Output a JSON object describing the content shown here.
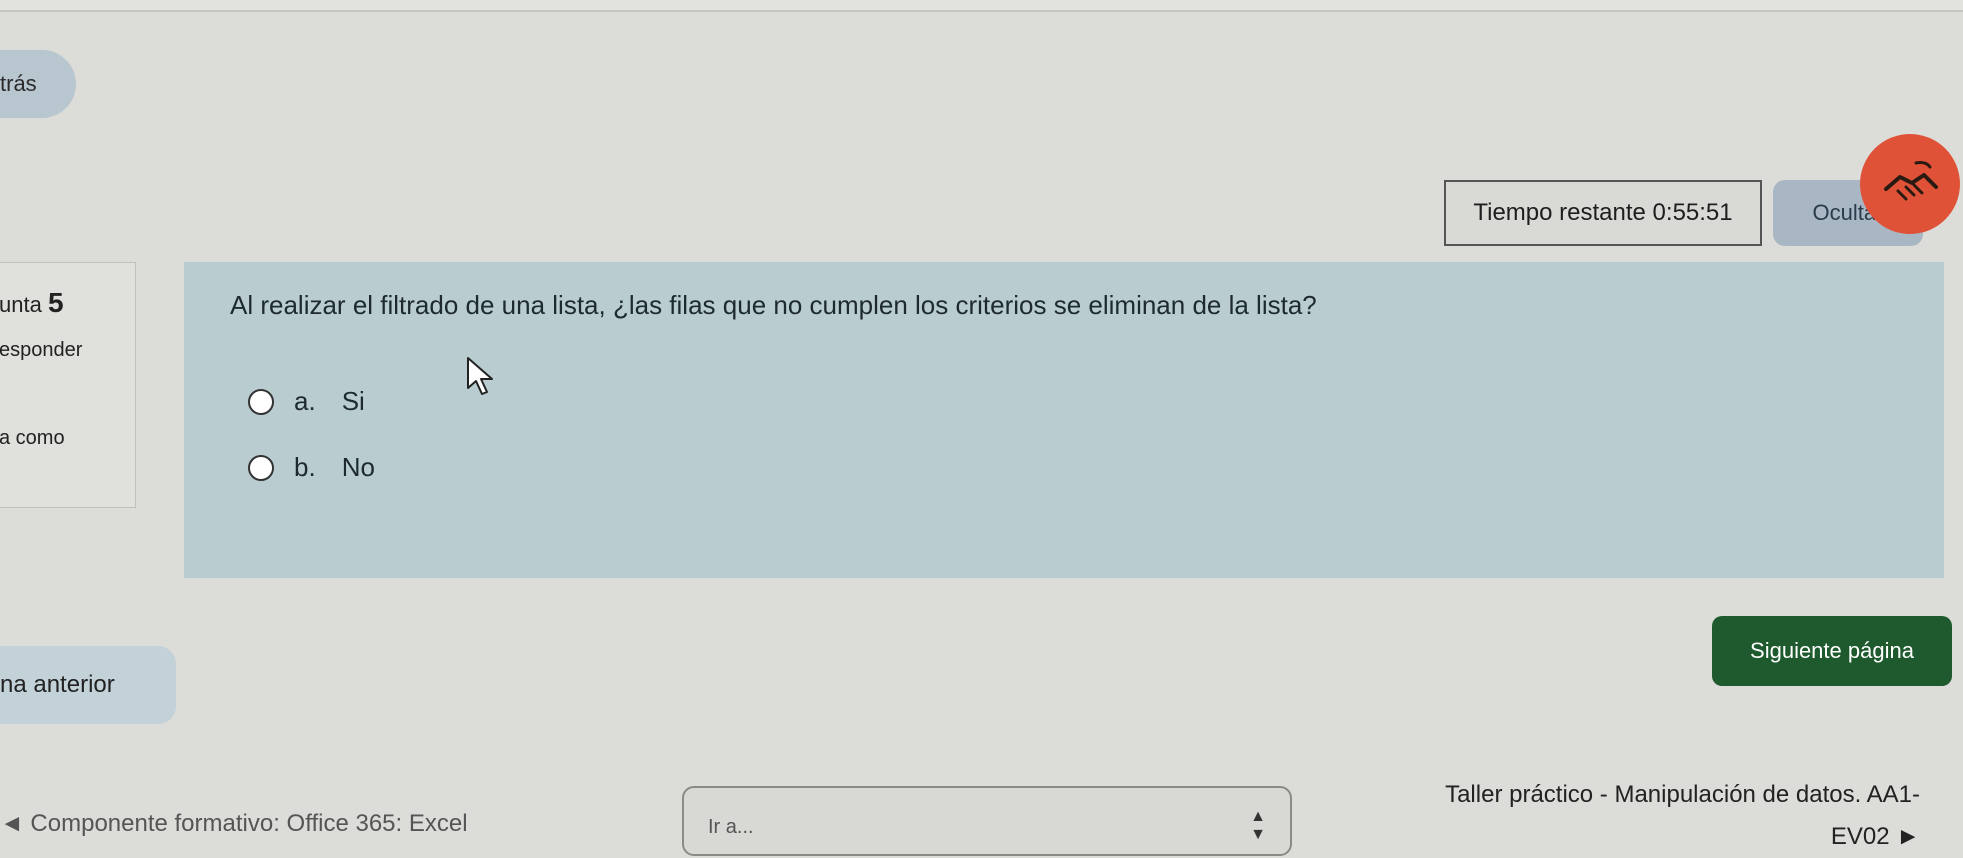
{
  "nav": {
    "back_label": "trás",
    "prev_label": "na anterior",
    "next_label": "Siguiente página"
  },
  "timer": {
    "label": "Tiempo restante 0:55:51",
    "hide_label": "Ocultar"
  },
  "question_info": {
    "number_prefix": "unta",
    "number": "5",
    "state": "esponder",
    "flag": "a como"
  },
  "question": {
    "text": "Al realizar el filtrado de una lista, ¿las filas que no cumplen los criterios se eliminan de la lista?",
    "options": [
      {
        "letter": "a.",
        "label": "Si"
      },
      {
        "letter": "b.",
        "label": "No"
      }
    ]
  },
  "footer": {
    "prev_activity": "◄ Componente formativo: Office 365: Excel",
    "jump_label": "Ir a...",
    "next_activity": "Taller práctico - Manipulación de datos. AA1-EV02 ►"
  },
  "colors": {
    "question_bg": "#b9ccd0",
    "next_button": "#1e5a2d",
    "tour_icon": "#e05238"
  }
}
